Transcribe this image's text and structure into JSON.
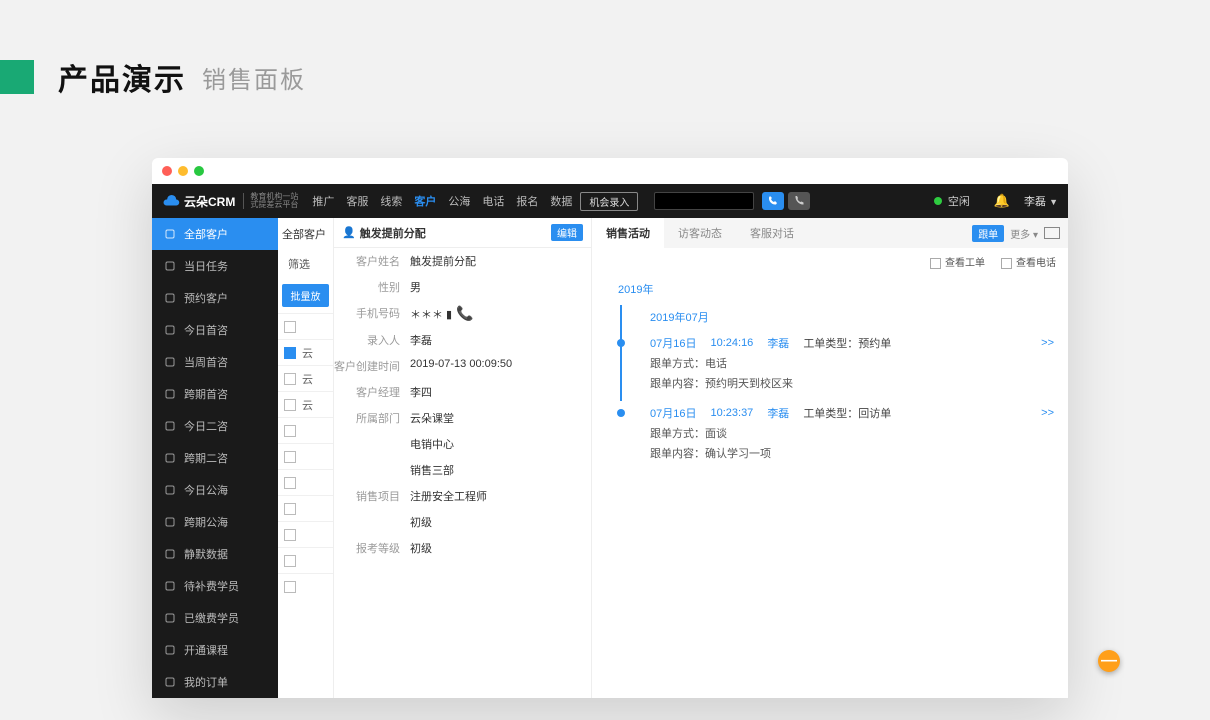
{
  "page": {
    "title": "产品演示",
    "subtitle": "销售面板"
  },
  "header": {
    "brand": "云朵CRM",
    "brand_sub1": "教育机构一站",
    "brand_sub2": "式提差云平台",
    "nav": [
      "推广",
      "客服",
      "线索",
      "客户",
      "公海",
      "电话",
      "报名",
      "数据"
    ],
    "nav_active": "客户",
    "opportunity_btn": "机会录入",
    "status_text": "空闲",
    "user_name": "李磊"
  },
  "sidebar": [
    {
      "icon": "user",
      "label": "全部客户",
      "active": true
    },
    {
      "icon": "check",
      "label": "当日任务"
    },
    {
      "icon": "person",
      "label": "预约客户"
    },
    {
      "icon": "chat",
      "label": "今日首咨"
    },
    {
      "icon": "chat",
      "label": "当周首咨"
    },
    {
      "icon": "loop",
      "label": "跨期首咨"
    },
    {
      "icon": "chat",
      "label": "今日二咨"
    },
    {
      "icon": "loop",
      "label": "跨期二咨"
    },
    {
      "icon": "globe",
      "label": "今日公海"
    },
    {
      "icon": "loop",
      "label": "跨期公海"
    },
    {
      "icon": "mute",
      "label": "静默数据"
    },
    {
      "icon": "money",
      "label": "待补费学员"
    },
    {
      "icon": "money",
      "label": "已缴费学员"
    },
    {
      "icon": "book",
      "label": "开通课程"
    },
    {
      "icon": "doc",
      "label": "我的订单"
    }
  ],
  "list": {
    "title": "全部客户",
    "filter_label": "筛选",
    "bulk_btn": "批量放",
    "rows": [
      {
        "sel": false,
        "text": ""
      },
      {
        "sel": true,
        "text": "云"
      },
      {
        "sel": false,
        "text": "云"
      },
      {
        "sel": false,
        "text": "云"
      },
      {
        "sel": false,
        "text": ""
      },
      {
        "sel": false,
        "text": ""
      },
      {
        "sel": false,
        "text": ""
      },
      {
        "sel": false,
        "text": ""
      },
      {
        "sel": false,
        "text": ""
      },
      {
        "sel": false,
        "text": ""
      },
      {
        "sel": false,
        "text": ""
      }
    ]
  },
  "detail": {
    "title": "触发提前分配",
    "edit_btn": "编辑",
    "fields": [
      {
        "label": "客户姓名",
        "value": "触发提前分配"
      },
      {
        "label": "性别",
        "value": "男"
      },
      {
        "label": "手机号码",
        "value": "＊＊＊ ▮",
        "phone": true
      },
      {
        "label": "录入人",
        "value": "李磊"
      },
      {
        "label": "客户创建时间",
        "value": "2019-07-13 00:09:50"
      },
      {
        "label": "客户经理",
        "value": "李四"
      },
      {
        "label": "所属部门",
        "value": "云朵课堂"
      },
      {
        "label": "",
        "value": "电销中心"
      },
      {
        "label": "",
        "value": "销售三部"
      },
      {
        "label": "销售项目",
        "value": "注册安全工程师"
      },
      {
        "label": "",
        "value": "初级"
      },
      {
        "label": "报考等级",
        "value": "初级"
      }
    ]
  },
  "activity": {
    "tabs": [
      "销售活动",
      "访客动态",
      "客服对话"
    ],
    "active_tab": "销售活动",
    "follow_btn": "跟单",
    "more_btn": "更多 ▾",
    "filter_ticket": "查看工单",
    "filter_call": "查看电话",
    "year": "2019年",
    "month": "2019年07月",
    "type_label": "工单类型：",
    "method_label": "跟单方式：",
    "content_label": "跟单内容：",
    "expand": ">>",
    "items": [
      {
        "date": "07月16日",
        "time": "10:24:16",
        "user": "李磊",
        "type": "预约单",
        "method": "电话",
        "content": "预约明天到校区来"
      },
      {
        "date": "07月16日",
        "time": "10:23:37",
        "user": "李磊",
        "type": "回访单",
        "method": "面谈",
        "content": "确认学习一项"
      }
    ]
  }
}
